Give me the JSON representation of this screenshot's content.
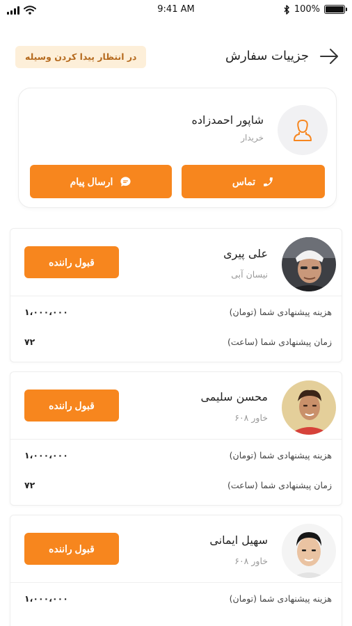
{
  "status_bar": {
    "time": "9:41 AM",
    "battery": "100%"
  },
  "header": {
    "title": "جزییات سفارش",
    "status_badge": "در انتظار پیدا کردن وسیله"
  },
  "buyer": {
    "name": "شاپور احمدزاده",
    "role": "خریدار",
    "call_label": "تماس",
    "message_label": "ارسال پیام"
  },
  "drivers": [
    {
      "name": "علی پیری",
      "car": "نیسان آبی",
      "accept_label": "قبول راننده",
      "cost_label": "هزینه پیشنهادی شما (تومان)",
      "cost_value": "۱،۰۰۰،۰۰۰",
      "time_label": "زمان پیشنهادی شما (ساعت)",
      "time_value": "۷۲"
    },
    {
      "name": "محسن سلیمی",
      "car": "خاور ۶۰۸",
      "accept_label": "قبول راننده",
      "cost_label": "هزینه پیشنهادی شما (تومان)",
      "cost_value": "۱،۰۰۰،۰۰۰",
      "time_label": "زمان پیشنهادی شما (ساعت)",
      "time_value": "۷۲"
    },
    {
      "name": "سهیل ایمانی",
      "car": "خاور ۶۰۸",
      "accept_label": "قبول راننده",
      "cost_label": "هزینه پیشنهادی شما (تومان)",
      "cost_value": "۱،۰۰۰،۰۰۰"
    }
  ],
  "colors": {
    "accent": "#f7861e",
    "badge_bg": "#fdefd9",
    "badge_text": "#b56a1e"
  },
  "icons": [
    "signal-icon",
    "wifi-icon",
    "bluetooth-icon",
    "battery-icon",
    "back-arrow-icon",
    "user-icon",
    "phone-icon",
    "chat-icon"
  ]
}
